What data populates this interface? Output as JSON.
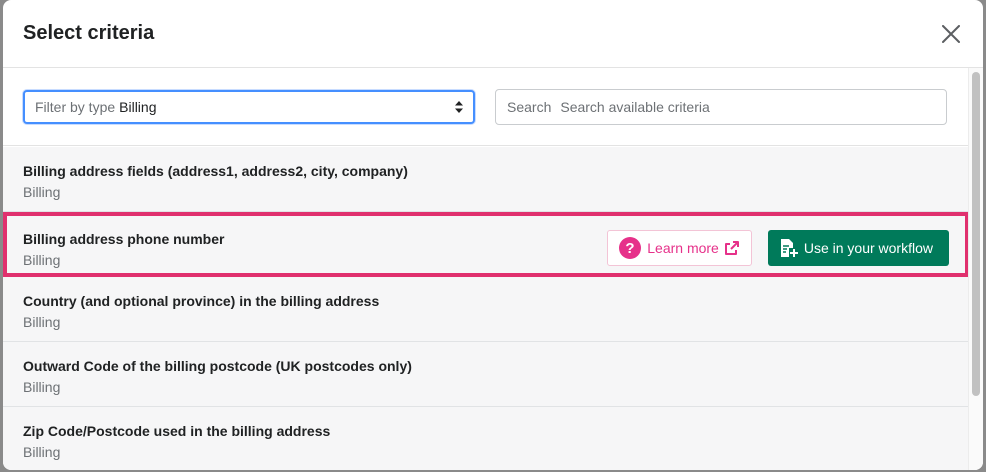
{
  "modal": {
    "title": "Select criteria"
  },
  "filter": {
    "prefix": "Filter by type",
    "value": "Billing"
  },
  "search": {
    "prefix": "Search",
    "placeholder": "Search available criteria"
  },
  "criteria": [
    {
      "name": "Billing address fields (address1, address2, city, company)",
      "type": "Billing"
    },
    {
      "name": "Billing address phone number",
      "type": "Billing"
    },
    {
      "name": "Country (and optional province) in the billing address",
      "type": "Billing"
    },
    {
      "name": "Outward Code of the billing postcode (UK postcodes only)",
      "type": "Billing"
    },
    {
      "name": "Zip Code/Postcode used in the billing address",
      "type": "Billing"
    }
  ],
  "actions": {
    "learn_more": "Learn more",
    "use_in_workflow": "Use in your workflow"
  },
  "colors": {
    "highlight": "#e0306e",
    "primary_button": "#007a5a",
    "learn_more": "#e6318a",
    "focus_ring": "#458fff"
  },
  "icons": [
    "close-icon",
    "select-arrows-icon",
    "question-icon",
    "external-link-icon",
    "document-add-icon"
  ]
}
